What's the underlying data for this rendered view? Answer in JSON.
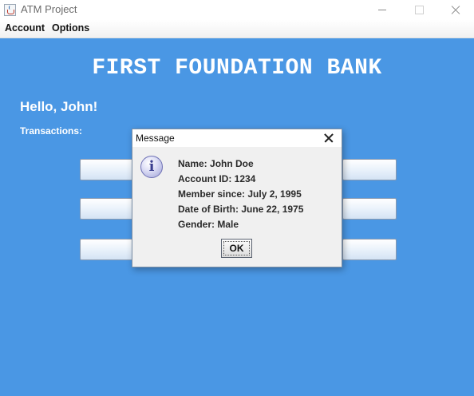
{
  "window": {
    "title": "ATM Project"
  },
  "menu": {
    "items": [
      "Account",
      "Options"
    ]
  },
  "main": {
    "bank_name": "FIRST FOUNDATION BANK",
    "greeting": "Hello, John!",
    "transactions_label": "Transactions:"
  },
  "dialog": {
    "title": "Message",
    "icon": "info-icon",
    "icon_glyph": "i",
    "lines": [
      "Name: John Doe",
      "Account ID: 1234",
      "Member since: July 2, 1995",
      "Date of Birth: June 22, 1975",
      "Gender: Male"
    ],
    "ok_label": "OK"
  },
  "colors": {
    "background": "#4a97e4",
    "text_on_background": "#ffffff",
    "dialog_bg": "#f0f0f0"
  }
}
